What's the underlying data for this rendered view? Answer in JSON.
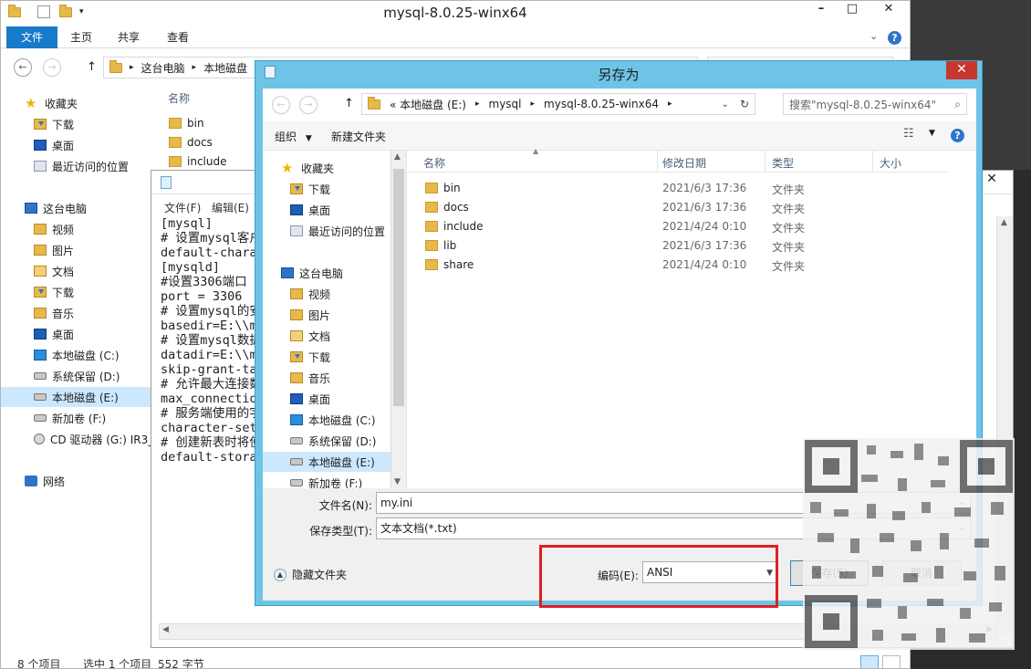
{
  "explorer": {
    "title": "mysql-8.0.25-winx64",
    "ribbon_tabs": [
      "文件",
      "主页",
      "共享",
      "查看"
    ],
    "breadcrumb": [
      "这台电脑",
      "本地磁盘"
    ],
    "column_name": "名称",
    "nav": {
      "favorites": "收藏夹",
      "downloads": "下载",
      "desktop": "桌面",
      "recent": "最近访问的位置",
      "this_pc": "这台电脑",
      "videos": "视频",
      "pictures": "图片",
      "documents": "文档",
      "downloads2": "下载",
      "music": "音乐",
      "desktop2": "桌面",
      "disk_c": "本地磁盘 (C:)",
      "disk_d": "系统保留 (D:)",
      "disk_e": "本地磁盘 (E:)",
      "disk_f": "新加卷 (F:)",
      "cd_g": "CD 驱动器 (G:) IR3_",
      "network": "网络"
    },
    "files": [
      "bin",
      "docs",
      "include"
    ],
    "status": {
      "count": "8 个项目",
      "selected": "选中 1 个项目",
      "size": "552 字节"
    }
  },
  "notepad": {
    "menu": [
      "文件(F)",
      "编辑(E)"
    ],
    "lines": [
      "[mysql]",
      "# 设置mysql客户端",
      "default-charact",
      "[mysqld]",
      "#设置3306端口",
      "port = 3306",
      "# 设置mysql的安",
      "basedir=E:\\\\mys",
      "# 设置mysql数据",
      "datadir=E:\\\\mys",
      "skip-grant-tabl",
      "# 允许最大连接数",
      "max_connections",
      "# 服务端使用的字",
      "character-set-s",
      "# 创建新表时将使",
      "default-storage"
    ]
  },
  "saveas": {
    "title": "另存为",
    "path": [
      "« 本地磁盘 (E:)",
      "mysql",
      "mysql-8.0.25-winx64"
    ],
    "search_placeholder": "搜索\"mysql-8.0.25-winx64\"",
    "toolbar": {
      "organize": "组织",
      "new_folder": "新建文件夹"
    },
    "nav": {
      "favorites": "收藏夹",
      "downloads": "下载",
      "desktop": "桌面",
      "recent": "最近访问的位置",
      "this_pc": "这台电脑",
      "videos": "视频",
      "pictures": "图片",
      "documents": "文档",
      "downloads2": "下载",
      "music": "音乐",
      "desktop2": "桌面",
      "disk_c": "本地磁盘 (C:)",
      "disk_d": "系统保留 (D:)",
      "disk_e": "本地磁盘 (E:)",
      "disk_f": "新加卷 (F:)"
    },
    "columns": {
      "name": "名称",
      "date": "修改日期",
      "type": "类型",
      "size": "大小"
    },
    "files": [
      {
        "name": "bin",
        "date": "2021/6/3 17:36",
        "type": "文件夹"
      },
      {
        "name": "docs",
        "date": "2021/6/3 17:36",
        "type": "文件夹"
      },
      {
        "name": "include",
        "date": "2021/4/24 0:10",
        "type": "文件夹"
      },
      {
        "name": "lib",
        "date": "2021/6/3 17:36",
        "type": "文件夹"
      },
      {
        "name": "share",
        "date": "2021/4/24 0:10",
        "type": "文件夹"
      }
    ],
    "filename_label": "文件名(N):",
    "filename_value": "my.ini",
    "filetype_label": "保存类型(T):",
    "filetype_value": "文本文档(*.txt)",
    "hide_folders": "隐藏文件夹",
    "encoding_label": "编码(E):",
    "encoding_value": "ANSI",
    "save_button": "保存(S)",
    "cancel_button": "取消",
    "highlight_color": "#e02020"
  }
}
